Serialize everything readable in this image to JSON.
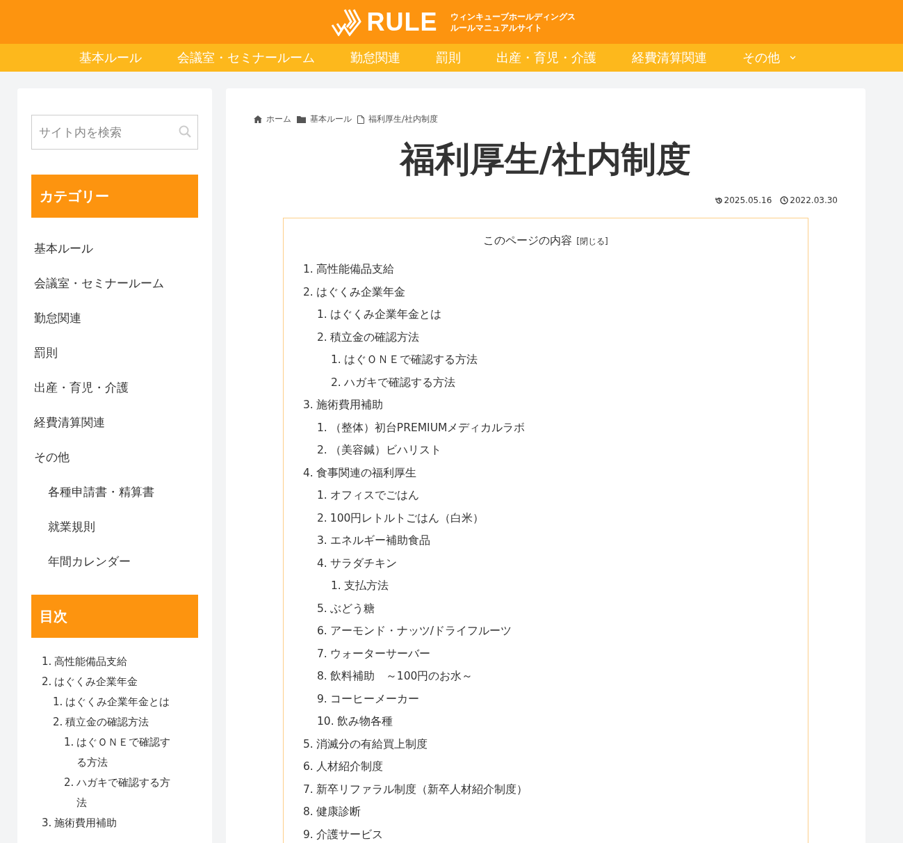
{
  "header": {
    "logo": "RULE",
    "tagline_1": "ウィンキューブホールディングス",
    "tagline_2": "ルールマニュアルサイト"
  },
  "nav": [
    {
      "label": "基本ルール",
      "dropdown": false
    },
    {
      "label": "会議室・セミナールーム",
      "dropdown": false
    },
    {
      "label": "勤怠関連",
      "dropdown": false
    },
    {
      "label": "罰則",
      "dropdown": false
    },
    {
      "label": "出産・育児・介護",
      "dropdown": false
    },
    {
      "label": "経費清算関連",
      "dropdown": false
    },
    {
      "label": "その他",
      "dropdown": true
    }
  ],
  "sidebar": {
    "search": {
      "placeholder": "サイト内を検索"
    },
    "category_heading": "カテゴリー",
    "categories": [
      {
        "label": "基本ルール"
      },
      {
        "label": "会議室・セミナールーム"
      },
      {
        "label": "勤怠関連"
      },
      {
        "label": "罰則"
      },
      {
        "label": "出産・育児・介護"
      },
      {
        "label": "経費清算関連"
      },
      {
        "label": "その他",
        "children": [
          {
            "label": "各種申請書・精算書"
          },
          {
            "label": "就業規則"
          },
          {
            "label": "年間カレンダー"
          }
        ]
      }
    ],
    "toc_heading": "目次",
    "toc": [
      {
        "num": "1.",
        "label": "高性能備品支給"
      },
      {
        "num": "2.",
        "label": "はぐくみ企業年金",
        "children": [
          {
            "num": "1.",
            "label": "はぐくみ企業年金とは"
          },
          {
            "num": "2.",
            "label": "積立金の確認方法",
            "children": [
              {
                "num": "1.",
                "label": "はぐＯＮＥで確認する方法"
              },
              {
                "num": "2.",
                "label": "ハガキで確認する方法"
              }
            ]
          }
        ]
      },
      {
        "num": "3.",
        "label": "施術費用補助"
      }
    ]
  },
  "breadcrumb": [
    {
      "kind": "home",
      "label": "ホーム"
    },
    {
      "kind": "folder",
      "label": "基本ルール"
    },
    {
      "kind": "page",
      "label": "福利厚生/社内制度"
    }
  ],
  "title": "福利厚生/社内制度",
  "dates": {
    "updated": "2025.05.16",
    "published": "2022.03.30"
  },
  "toc": {
    "title": "このページの内容",
    "toggle": "[閉じる]",
    "items": [
      {
        "num": "1.",
        "label": "高性能備品支給"
      },
      {
        "num": "2.",
        "label": "はぐくみ企業年金",
        "children": [
          {
            "num": "1.",
            "label": "はぐくみ企業年金とは"
          },
          {
            "num": "2.",
            "label": "積立金の確認方法",
            "children": [
              {
                "num": "1.",
                "label": "はぐＯＮＥで確認する方法"
              },
              {
                "num": "2.",
                "label": "ハガキで確認する方法"
              }
            ]
          }
        ]
      },
      {
        "num": "3.",
        "label": "施術費用補助",
        "children": [
          {
            "num": "1.",
            "label": "（整体）初台PREMIUMメディカルラボ"
          },
          {
            "num": "2.",
            "label": "（美容鍼）ビハリスト"
          }
        ]
      },
      {
        "num": "4.",
        "label": "食事関連の福利厚生",
        "children": [
          {
            "num": "1.",
            "label": "オフィスでごはん"
          },
          {
            "num": "2.",
            "label": "100円レトルトごはん（白米）"
          },
          {
            "num": "3.",
            "label": "エネルギー補助食品"
          },
          {
            "num": "4.",
            "label": "サラダチキン",
            "children": [
              {
                "num": "1.",
                "label": "支払方法"
              }
            ]
          },
          {
            "num": "5.",
            "label": "ぶどう糖"
          },
          {
            "num": "6.",
            "label": "アーモンド・ナッツ/ドライフルーツ"
          },
          {
            "num": "7.",
            "label": "ウォーターサーバー"
          },
          {
            "num": "8.",
            "label": "飲料補助　～100円のお水～"
          },
          {
            "num": "9.",
            "label": "コーヒーメーカー"
          },
          {
            "num": "10.",
            "label": "飲み物各種"
          }
        ]
      },
      {
        "num": "5.",
        "label": "消滅分の有給買上制度"
      },
      {
        "num": "6.",
        "label": "人材紹介制度"
      },
      {
        "num": "7.",
        "label": "新卒リファラル制度（新卒人材紹介制度）"
      },
      {
        "num": "8.",
        "label": "健康診断"
      },
      {
        "num": "9.",
        "label": "介護サービス"
      }
    ]
  }
}
